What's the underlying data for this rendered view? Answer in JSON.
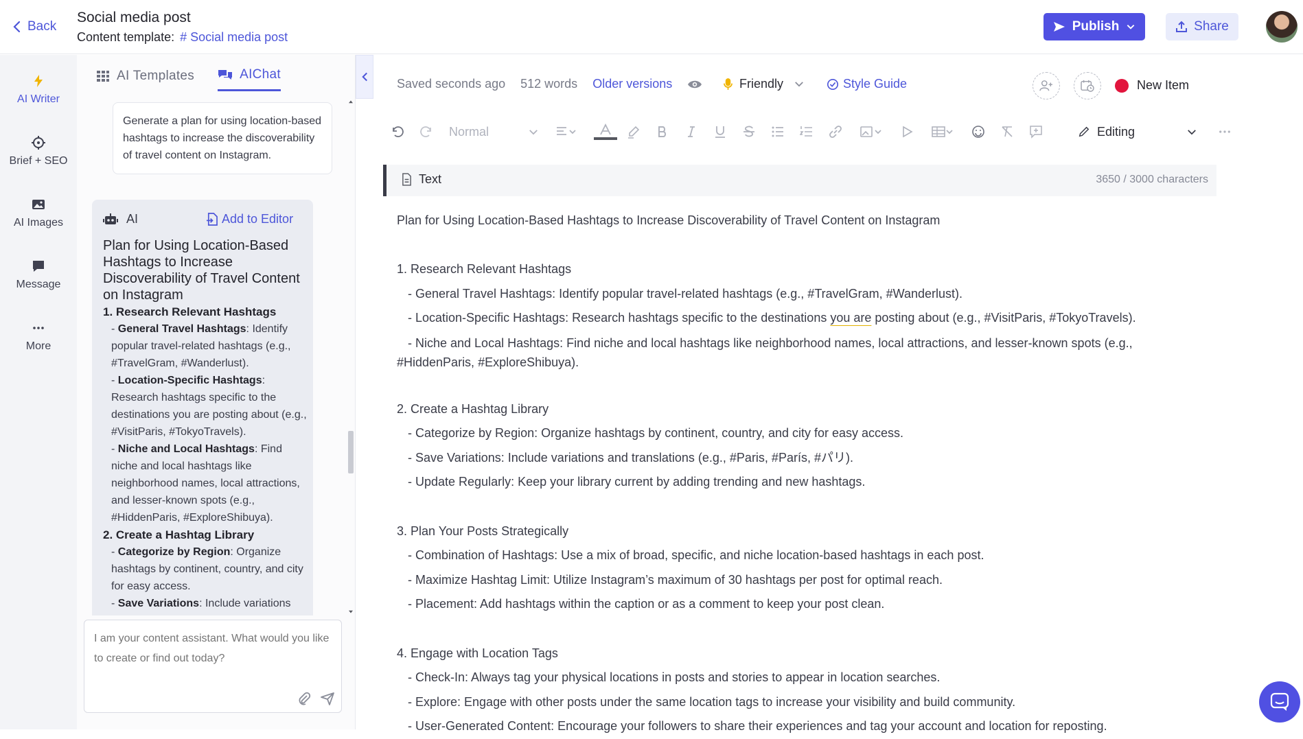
{
  "header": {
    "back_label": "Back",
    "title": "Social media post",
    "template_label": "Content template:",
    "template_name": "Social media post",
    "publish_label": "Publish",
    "share_label": "Share"
  },
  "leftnav": {
    "items": [
      {
        "label": "AI Writer",
        "icon": "bolt-icon"
      },
      {
        "label": "Brief + SEO",
        "icon": "crosshair-icon"
      },
      {
        "label": "AI Images",
        "icon": "image-icon"
      },
      {
        "label": "Message",
        "icon": "message-icon"
      },
      {
        "label": "More",
        "icon": "more-icon"
      }
    ]
  },
  "chat": {
    "tabs": [
      {
        "label": "AI Templates",
        "icon": "grid-icon",
        "active": false
      },
      {
        "label": "AIChat",
        "icon": "chat-icon",
        "active": true
      }
    ],
    "user_message": "Generate a plan for using location-based hashtags to increase the discoverability of travel content on Instagram.",
    "ai_label": "AI",
    "add_to_editor": "Add to Editor",
    "ai_title": "Plan for Using Location-Based Hashtags to Increase Discoverability of Travel Content on Instagram",
    "ai_sections": [
      {
        "heading": "1. Research Relevant Hashtags",
        "bullets": [
          {
            "bold": "General Travel Hashtags",
            "text": ": Identify popular travel-related hashtags (e.g., #TravelGram, #Wanderlust)."
          },
          {
            "bold": "Location-Specific Hashtags",
            "text": ": Research hashtags specific to the destinations you are posting about (e.g., #VisitParis, #TokyoTravels)."
          },
          {
            "bold": "Niche and Local Hashtags",
            "text": ": Find niche and local hashtags like neighborhood names, local attractions, and lesser-known spots (e.g., #HiddenParis, #ExploreShibuya)."
          }
        ]
      },
      {
        "heading": "2. Create a Hashtag Library",
        "bullets": [
          {
            "bold": "Categorize by Region",
            "text": ": Organize hashtags by continent, country, and city for easy access."
          },
          {
            "bold": "Save Variations",
            "text": ": Include variations"
          }
        ]
      }
    ],
    "input_placeholder": "I am your content assistant. What would you like to create or find out today?"
  },
  "editor": {
    "saved": "Saved seconds ago",
    "words": "512 words",
    "older_versions": "Older versions",
    "tone": "Friendly",
    "style_guide": "Style Guide",
    "new_item": "New Item",
    "status_color": "#e2153d",
    "toolbar_style": "Normal",
    "mode": "Editing",
    "field_label": "Text",
    "char_count": "3650 / 3000 characters",
    "doc_title": "Plan for Using Location-Based Hashtags to Increase Discoverability of Travel Content on Instagram",
    "s1_head": "1. Research Relevant Hashtags",
    "s1_b1": "- General Travel Hashtags: Identify popular travel-related hashtags (e.g., #TravelGram, #Wanderlust).",
    "s1_b2_pre": "- Location-Specific Hashtags: Research hashtags specific to the destinations ",
    "s1_b2_mark": "you are",
    "s1_b2_post": " posting about (e.g., #VisitParis, #TokyoTravels).",
    "s1_b3a": "- Niche and Local Hashtags: Find niche and local hashtags like neighborhood names, local attractions, and lesser-known spots (e.g.,",
    "s1_b3b": "#HiddenParis, #ExploreShibuya).",
    "s2_head": "2. Create a Hashtag Library",
    "s2_b1": "- Categorize by Region: Organize hashtags by continent, country, and city for easy access.",
    "s2_b2": "- Save Variations: Include variations and translations (e.g., #Paris, #París, #パリ).",
    "s2_b3": "- Update Regularly: Keep your library current by adding trending and new hashtags.",
    "s3_head": "3. Plan Your Posts Strategically",
    "s3_b1": "- Combination of Hashtags: Use a mix of broad, specific, and niche location-based hashtags in each post.",
    "s3_b2": "- Maximize Hashtag Limit: Utilize Instagram’s maximum of 30 hashtags per post for optimal reach.",
    "s3_b3": "- Placement: Add hashtags within the caption or as a comment to keep your post clean.",
    "s4_head": "4. Engage with Location Tags",
    "s4_b1": "- Check-In: Always tag your physical locations in posts and stories to appear in location searches.",
    "s4_b2": "- Explore: Engage with other posts under the same location tags to increase your visibility and build community.",
    "s4_b3": "- User-Generated Content: Encourage your followers to share their experiences and tag your account and location for reposting."
  }
}
